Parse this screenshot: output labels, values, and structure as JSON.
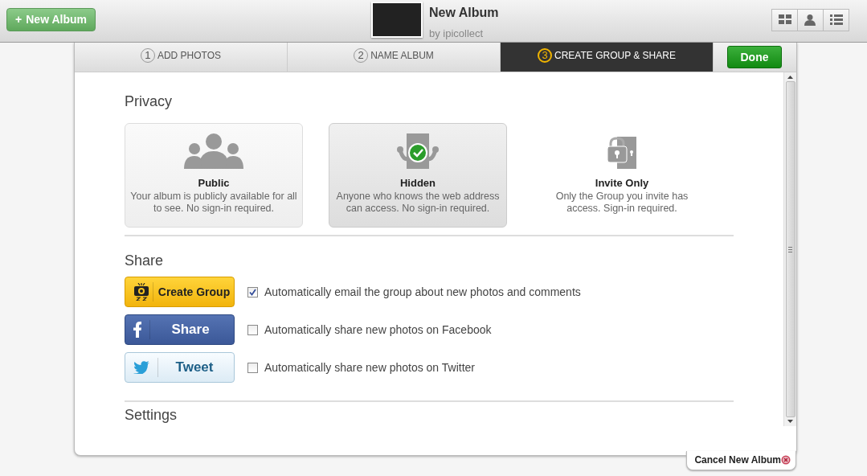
{
  "top_bar": {
    "new_album_button": {
      "icon": "+",
      "label": "New Album"
    },
    "album": {
      "title": "New Album",
      "byline": "by ipicollect"
    },
    "view_buttons": [
      {
        "kind": "grid",
        "selected": false
      },
      {
        "kind": "person",
        "selected": false
      },
      {
        "kind": "list",
        "selected": false
      }
    ]
  },
  "steps": [
    {
      "number": "1",
      "label": "ADD PHOTOS",
      "selected": false
    },
    {
      "number": "2",
      "label": "NAME ALBUM",
      "selected": false
    },
    {
      "number": "3",
      "label": "CREATE GROUP & SHARE",
      "selected": true
    }
  ],
  "done_button": "Done",
  "privacy": {
    "heading": "Privacy",
    "options": [
      {
        "kind": "public",
        "title": "Public",
        "description": "Your album is publicly available for all to see. No sign-in required.",
        "selected": false,
        "hovered": true
      },
      {
        "kind": "hidden",
        "title": "Hidden",
        "description": "Anyone who knows the web address can access. No sign-in required.",
        "selected": true,
        "hovered": false
      },
      {
        "kind": "invite",
        "title": "Invite Only",
        "description": "Only the Group you invite has access. Sign-in required.",
        "selected": false,
        "hovered": false
      }
    ]
  },
  "share": {
    "heading": "Share",
    "rows": [
      {
        "kind": "group",
        "button": "Create Group",
        "option": "Automatically email the group about new photos and comments",
        "checked": true
      },
      {
        "kind": "facebook",
        "button": "Share",
        "option": "Automatically share new photos on Facebook",
        "checked": false
      },
      {
        "kind": "twitter",
        "button": "Tweet",
        "option": "Automatically share new photos on Twitter",
        "checked": false
      }
    ]
  },
  "settings": {
    "heading": "Settings"
  },
  "cancel_link": "Cancel New Album"
}
